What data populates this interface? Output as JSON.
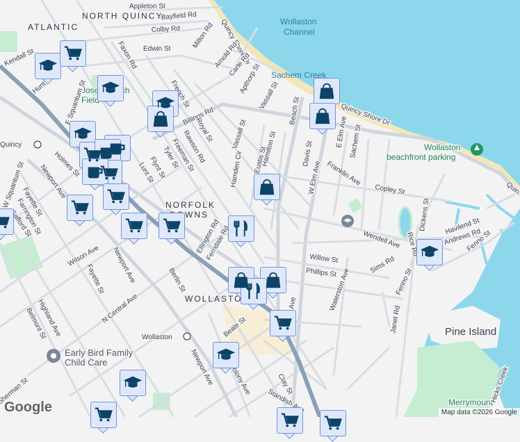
{
  "neighborhoods": {
    "north_quincy": "NORTH QUINCY",
    "atlantic": "ATLANTIC",
    "norfolk": "NORFOLK",
    "downs": "DOWNS",
    "wollaston": "WOLLASTON"
  },
  "water": {
    "wollaston_channel_1": "Wollaston",
    "wollaston_channel_2": "Channel",
    "sachem_creek": "Sachem Creek"
  },
  "places": {
    "pine_island": "Pine Island",
    "merrymount": "Merrymount",
    "beach_parking_1": "Wollaston",
    "beach_parking_2": "beachfront parking",
    "early_bird_1": "Early Bird Family",
    "early_bird_2": "Child Care",
    "koch_field_1": "Joseph Koch",
    "koch_field_2": "Field",
    "north_quincy_station": "Quincy",
    "wollaston_station": "Wollaston"
  },
  "streets": {
    "bayfield": "Bayfield Rd",
    "colby": "Colby Rd",
    "edwin": "Edwin St",
    "milton": "Milton Rd",
    "quincy_shore": "Quincy Shore Dr",
    "quincy_shore2": "Quincy Shore Dr",
    "quincy_shore3": "Quin",
    "arnold": "Arnold Rd",
    "carle": "Carle Rd",
    "apthorp": "Apthorp St",
    "vassall": "Vassall St",
    "vassall2": "Vassall St",
    "faxon": "Faxon Rd",
    "kendall": "Kendall St",
    "hunt": "Hunt St",
    "e_squantum": "E Squantum St",
    "w_squantum": "W Squantum St",
    "french": "French St",
    "billings": "Billings Rd",
    "billings2": "Billings Rd",
    "royal": "Royal St",
    "rawson": "Rawson Rd",
    "freeman": "Freeman St",
    "tyler": "Tyler St",
    "flynt": "Flynt St",
    "lunt": "Lunt St",
    "holmes": "Holmes St",
    "newport": "Newport Ave",
    "newport2": "Newport Ave",
    "newport3": "Newport Ave",
    "fayette": "Fayette St",
    "fayette2": "Fayette St",
    "farrington": "Farrington St",
    "safford": "Safford St",
    "beach": "Beach St",
    "hamilton": "Hamilton St",
    "eustis": "Eustis St",
    "hamden": "Hamden Cir",
    "davis": "Davis St",
    "w_elm": "W Elm Ave",
    "w_elm2": "Ave",
    "e_elm": "E Elm Ave",
    "sachem": "Sachem St",
    "franklin": "Franklin Ave",
    "copley": "Copley St",
    "dickens": "Dickens St",
    "havilend": "Havilend St",
    "andrews": "Andrews Rd",
    "fenno": "Fenno St",
    "fenno2": "Fenno St",
    "rice": "Rice Rd",
    "wendell": "Wendell Ave",
    "sims": "Sims Rd",
    "willow": "Willow St",
    "phillips": "Phillips St",
    "waterston": "Waterston Ave",
    "janet": "Janet Rd",
    "ellington": "Ellington Rd",
    "ferndale": "Ferndale Rd",
    "berlin": "Berlin St",
    "wilson": "Wilson Ave",
    "n_central": "N Central Ave",
    "highland": "Highland Ave",
    "belmont": "Belmont St",
    "beale": "Beale St",
    "clay": "Clay St",
    "standish": "Standish Ave",
    "colony": "Colony Ave",
    "sherman": "Sherman St",
    "appleton": "Appleton St",
    "hicks_creek": "Hicks Creek"
  },
  "markers": [
    "education",
    "grocery",
    "education",
    "education",
    "shopping",
    "education",
    "grocery",
    "cafe",
    "cafe",
    "grocery",
    "cafe",
    "grocery",
    "grocery",
    "grocery",
    "grocery",
    "grocery",
    "shopping",
    "shopping",
    "shopping",
    "restaurant",
    "shopping",
    "shopping",
    "restaurant",
    "grocery",
    "education",
    "education",
    "education",
    "grocery",
    "grocery",
    "grocery"
  ],
  "attribution": {
    "logo": "Google",
    "map_data": "Map data ©2026 Google"
  },
  "colors": {
    "water": "#8dd7ec",
    "marker_fill": "#dfe8fb",
    "marker_border": "#6f94d6",
    "icon": "#0c4467",
    "park": "#c6ecd2",
    "sand": "#f7eccd"
  }
}
